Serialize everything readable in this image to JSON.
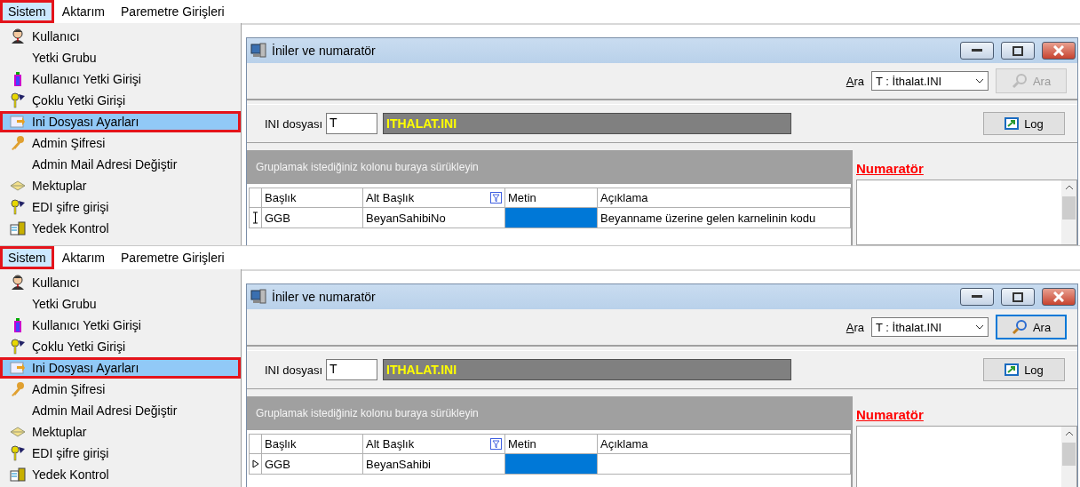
{
  "panels": [
    {
      "menubar": [
        {
          "label": "Sistem",
          "selected": true,
          "highlighted": true
        },
        {
          "label": "Aktarım",
          "selected": false,
          "highlighted": false
        },
        {
          "label": "Paremetre Girişleri",
          "selected": false,
          "highlighted": false
        }
      ],
      "menu_items": [
        {
          "label": "Kullanıcı",
          "kind": "user",
          "selected": false
        },
        {
          "label": "Yetki Grubu",
          "kind": "none",
          "selected": false
        },
        {
          "label": "Kullanıcı Yetki Girişi",
          "kind": "bottle",
          "selected": false
        },
        {
          "label": "Çoklu Yetki Girişi",
          "kind": "keys",
          "selected": false
        },
        {
          "label": "Ini Dosyası  Ayarları",
          "kind": "ini",
          "selected": true
        },
        {
          "label": "Admin Şifresi",
          "kind": "key",
          "selected": false
        },
        {
          "label": "Admin Mail Adresi Değiştir",
          "kind": "none",
          "selected": false
        },
        {
          "label": "Mektuplar",
          "kind": "letter",
          "selected": false
        },
        {
          "label": "EDI şifre girişi",
          "kind": "keys",
          "selected": false
        },
        {
          "label": "Yedek Kontrol",
          "kind": "backup",
          "selected": false
        }
      ],
      "window": {
        "title": "İniler ve numaratör",
        "search_label": "Ara",
        "search_value": "T : İthalat.INI",
        "search_button": {
          "label": "Ara",
          "disabled": true
        },
        "ini_label": "INI dosyası",
        "ini_value": "T",
        "ini_name": "ITHALAT.INI",
        "log_button": "Log",
        "group_hint": "Gruplamak istediğiniz kolonu buraya sürükleyin",
        "columns": [
          {
            "label": "Başlık",
            "filtered": false
          },
          {
            "label": "Alt Başlık",
            "filtered": true
          },
          {
            "label": "Metin",
            "filtered": false
          },
          {
            "label": "Açıklama",
            "filtered": false
          }
        ],
        "rows": [
          {
            "editing": true,
            "cells": [
              {
                "text": "GGB",
                "selected": false
              },
              {
                "text": "BeyanSahibiNo",
                "selected": false
              },
              {
                "selected": true
              },
              {
                "text": "Beyanname üzerine gelen karnelinin kodu",
                "selected": false
              }
            ]
          }
        ],
        "numarator_title": "Numaratör"
      }
    },
    {
      "menubar": [
        {
          "label": "Sistem",
          "selected": true,
          "highlighted": true
        },
        {
          "label": "Aktarım",
          "selected": false,
          "highlighted": false
        },
        {
          "label": "Paremetre Girişleri",
          "selected": false,
          "highlighted": false
        }
      ],
      "menu_items": [
        {
          "label": "Kullanıcı",
          "kind": "user",
          "selected": false
        },
        {
          "label": "Yetki Grubu",
          "kind": "none",
          "selected": false
        },
        {
          "label": "Kullanıcı Yetki Girişi",
          "kind": "bottle",
          "selected": false
        },
        {
          "label": "Çoklu Yetki Girişi",
          "kind": "keys",
          "selected": false
        },
        {
          "label": "Ini Dosyası  Ayarları",
          "kind": "ini",
          "selected": true
        },
        {
          "label": "Admin Şifresi",
          "kind": "key",
          "selected": false
        },
        {
          "label": "Admin Mail Adresi Değiştir",
          "kind": "none",
          "selected": false
        },
        {
          "label": "Mektuplar",
          "kind": "letter",
          "selected": false
        },
        {
          "label": "EDI şifre girişi",
          "kind": "keys",
          "selected": false
        },
        {
          "label": "Yedek Kontrol",
          "kind": "backup",
          "selected": false
        }
      ],
      "window": {
        "title": "İniler ve numaratör",
        "search_label": "Ara",
        "search_value": "T : İthalat.INI",
        "search_button": {
          "label": "Ara",
          "disabled": false
        },
        "ini_label": "INI dosyası",
        "ini_value": "T",
        "ini_name": "ITHALAT.INI",
        "log_button": "Log",
        "group_hint": "Gruplamak istediğiniz kolonu buraya sürükleyin",
        "columns": [
          {
            "label": "Başlık",
            "filtered": false
          },
          {
            "label": "Alt Başlık",
            "filtered": true
          },
          {
            "label": "Metin",
            "filtered": false
          },
          {
            "label": "Açıklama",
            "filtered": false
          }
        ],
        "rows": [
          {
            "editing": false,
            "cells": [
              {
                "text": "GGB",
                "selected": false
              },
              {
                "text": "BeyanSahibi",
                "selected": false
              },
              {
                "selected": true
              },
              {
                "selected": false
              }
            ]
          }
        ],
        "numarator_title": "Numaratör"
      }
    }
  ]
}
